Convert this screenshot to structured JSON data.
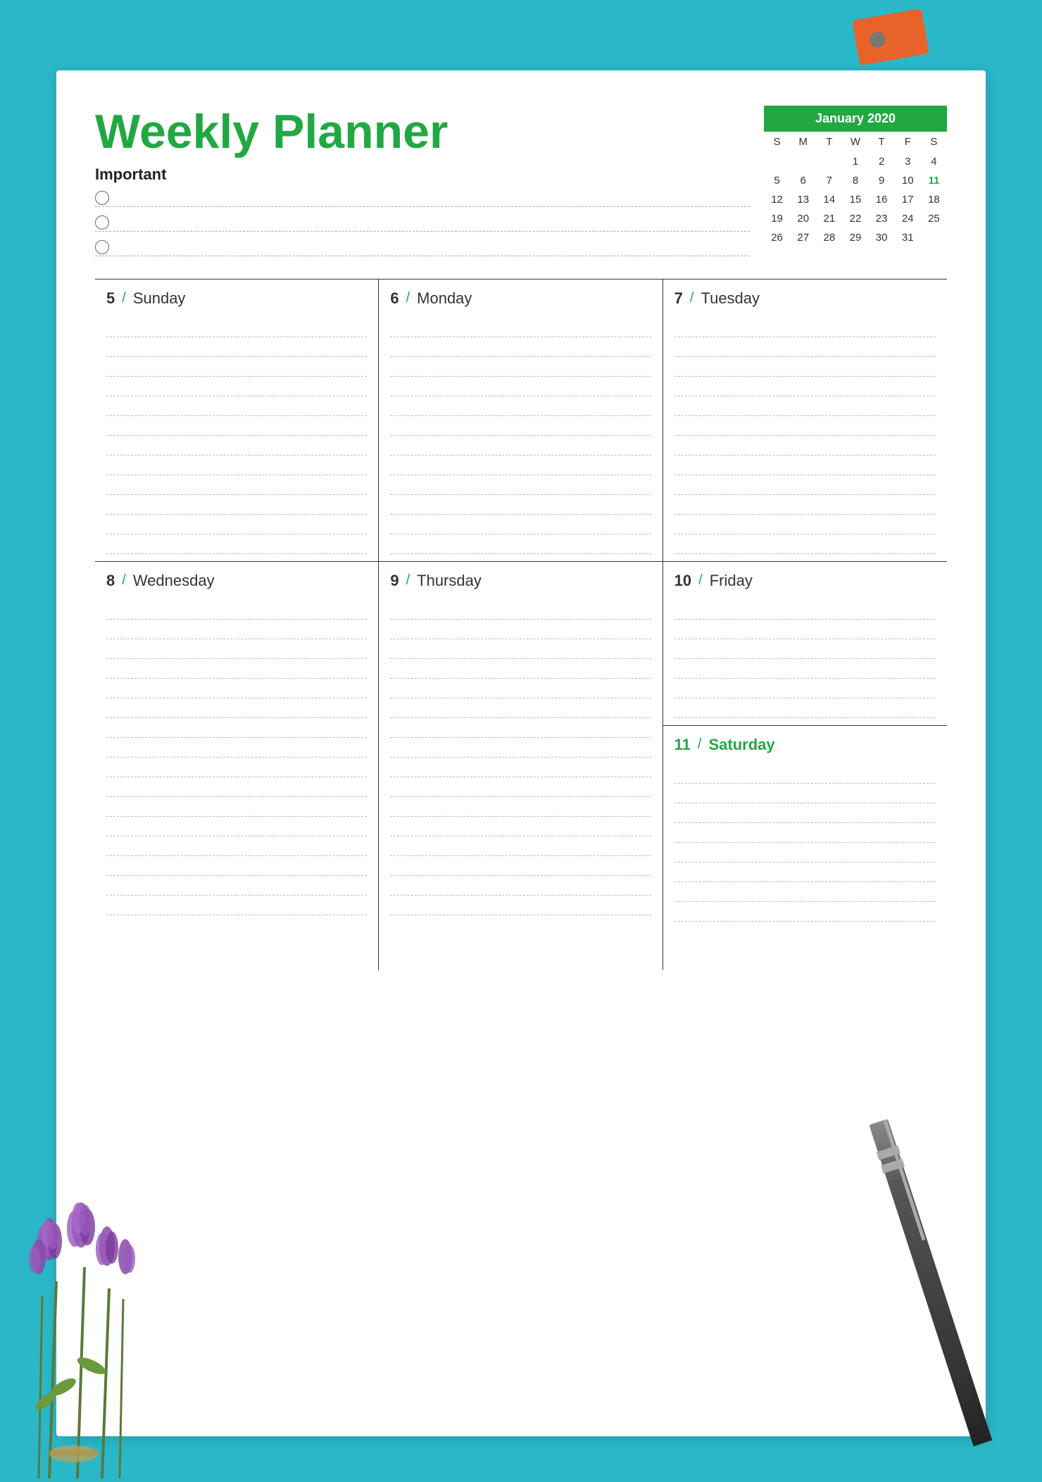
{
  "background": {
    "color": "#2ab8c8"
  },
  "paper": {
    "title": "Weekly Planner",
    "important_label": "Important",
    "bullets": [
      "",
      "",
      ""
    ]
  },
  "calendar": {
    "month_year": "January 2020",
    "headers": [
      "S",
      "M",
      "T",
      "W",
      "T",
      "F",
      "S"
    ],
    "weeks": [
      [
        "",
        "",
        "",
        "1",
        "2",
        "3",
        "4"
      ],
      [
        "5",
        "6",
        "7",
        "8",
        "9",
        "10",
        "11"
      ],
      [
        "12",
        "13",
        "14",
        "15",
        "16",
        "17",
        "18"
      ],
      [
        "19",
        "20",
        "21",
        "22",
        "23",
        "24",
        "25"
      ],
      [
        "26",
        "27",
        "28",
        "29",
        "30",
        "31",
        ""
      ]
    ]
  },
  "days": [
    {
      "num": "5",
      "name": "Sunday",
      "green": false
    },
    {
      "num": "6",
      "name": "Monday",
      "green": false
    },
    {
      "num": "7",
      "name": "Tuesday",
      "green": false
    },
    {
      "num": "8",
      "name": "Wednesday",
      "green": false
    },
    {
      "num": "9",
      "name": "Thursday",
      "green": false
    },
    {
      "num": "10",
      "name": "Friday",
      "green": false
    },
    {
      "num": "11",
      "name": "Saturday",
      "green": true
    }
  ],
  "lines_per_day": 12
}
